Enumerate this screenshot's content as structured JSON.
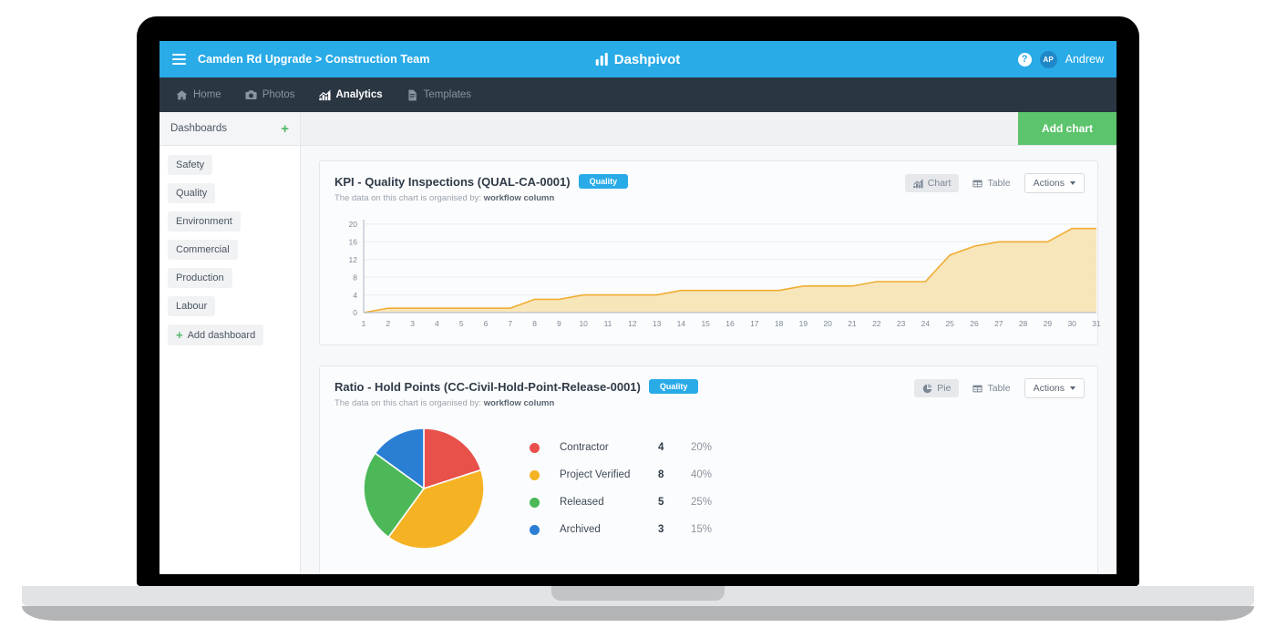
{
  "topbar": {
    "menu_icon": "hamburger-icon",
    "breadcrumb": "Camden Rd Upgrade > Construction Team",
    "brand": "Dashpivot",
    "help_icon": "help-circle-icon",
    "avatar_initials": "AP",
    "user_name": "Andrew",
    "accent_color": "#29abe8"
  },
  "nav": {
    "items": [
      {
        "label": "Home",
        "icon": "home-icon",
        "active": false
      },
      {
        "label": "Photos",
        "icon": "camera-icon",
        "active": false
      },
      {
        "label": "Analytics",
        "icon": "bar-chart-icon",
        "active": true
      },
      {
        "label": "Templates",
        "icon": "document-icon",
        "active": false
      }
    ]
  },
  "sidebar": {
    "title": "Dashboards",
    "add_icon": "plus-icon",
    "items": [
      {
        "label": "Safety"
      },
      {
        "label": "Quality"
      },
      {
        "label": "Environment"
      },
      {
        "label": "Commercial"
      },
      {
        "label": "Production"
      },
      {
        "label": "Labour"
      }
    ],
    "add_dashboard_label": "Add dashboard"
  },
  "toolbar": {
    "add_chart_label": "Add chart",
    "add_chart_color": "#5cc46c"
  },
  "cards": [
    {
      "title": "KPI - Quality Inspections (QUAL-CA-0001)",
      "badge": "Quality",
      "subtitle_prefix": "The data on this chart is organised by:",
      "subtitle_strong": "workflow column",
      "view_primary": {
        "label": "Chart",
        "icon": "area-chart-icon",
        "active": true
      },
      "view_table": {
        "label": "Table",
        "icon": "table-icon",
        "active": false
      },
      "actions_label": "Actions"
    },
    {
      "title": "Ratio - Hold Points (CC-Civil-Hold-Point-Release-0001)",
      "badge": "Quality",
      "subtitle_prefix": "The data on this chart is organised by:",
      "subtitle_strong": "workflow column",
      "view_primary": {
        "label": "Pie",
        "icon": "pie-chart-icon",
        "active": true
      },
      "view_table": {
        "label": "Table",
        "icon": "table-icon",
        "active": false
      },
      "actions_label": "Actions"
    }
  ],
  "chart_data": [
    {
      "type": "area",
      "title": "KPI - Quality Inspections (QUAL-CA-0001)",
      "xlabel": "",
      "ylabel": "",
      "grid": true,
      "legend": "none",
      "line_color": "#f0ad32",
      "fill_color": "#f7e3b4",
      "x": [
        1,
        2,
        3,
        4,
        5,
        6,
        7,
        8,
        9,
        10,
        11,
        12,
        13,
        14,
        15,
        16,
        17,
        18,
        19,
        20,
        21,
        22,
        23,
        24,
        25,
        26,
        27,
        28,
        29,
        30,
        31
      ],
      "xticklabels": [
        "1",
        "2",
        "3",
        "4",
        "5",
        "6",
        "7",
        "8",
        "9",
        "10",
        "11",
        "12",
        "13",
        "14",
        "15",
        "16",
        "17",
        "18",
        "19",
        "20",
        "21",
        "22",
        "23",
        "24",
        "25",
        "26",
        "27",
        "28",
        "29",
        "30",
        "31"
      ],
      "values": [
        0,
        1,
        1,
        1,
        1,
        1,
        1,
        3,
        3,
        4,
        4,
        4,
        4,
        5,
        5,
        5,
        5,
        5,
        6,
        6,
        6,
        7,
        7,
        7,
        13,
        15,
        16,
        16,
        16,
        19,
        19
      ],
      "ylim": [
        0,
        21
      ],
      "yticks": [
        0,
        4,
        8,
        12,
        16,
        20
      ],
      "yticklabels": [
        "0",
        "4",
        "8",
        "12",
        "16",
        "20"
      ]
    },
    {
      "type": "pie",
      "title": "Ratio - Hold Points (CC-Civil-Hold-Point-Release-0001)",
      "legend": "right",
      "labels": [
        "Contractor",
        "Project Verified",
        "Released",
        "Archived"
      ],
      "values": [
        4,
        8,
        5,
        3
      ],
      "percents": [
        "20%",
        "40%",
        "25%",
        "15%"
      ],
      "colors": [
        "#e8504a",
        "#f5b324",
        "#4cb857",
        "#2a7fd4"
      ]
    }
  ]
}
